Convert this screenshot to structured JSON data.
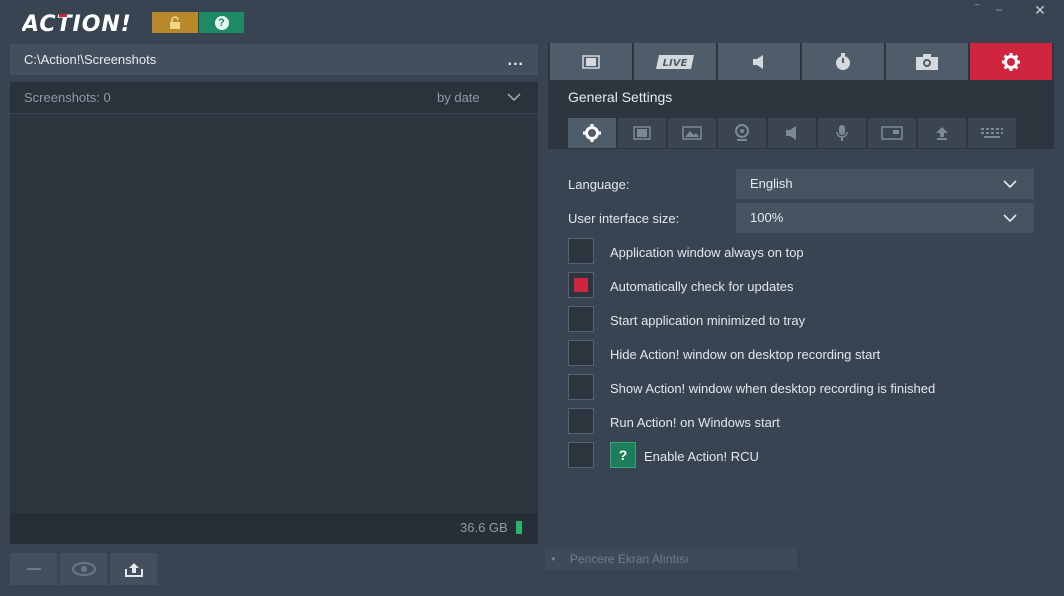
{
  "app": {
    "logo_text": "ACTION!",
    "lock_icon": "lock-icon",
    "help_label": "?",
    "window_buttons": {
      "minimize": "‾",
      "restore": "−",
      "close": "✕"
    }
  },
  "left": {
    "path": "C:\\Action!\\Screenshots",
    "path_more": "...",
    "count_label": "Screenshots: 0",
    "sort_label": "by date",
    "disk_free": "36.6 GB"
  },
  "right": {
    "top_tabs": [
      {
        "name": "video-tab",
        "icon": "film-icon"
      },
      {
        "name": "live-tab",
        "icon": "live-icon",
        "label": "LIVE"
      },
      {
        "name": "audio-tab",
        "icon": "speaker-icon"
      },
      {
        "name": "benchmark-tab",
        "icon": "stopwatch-icon"
      },
      {
        "name": "screenshot-tab",
        "icon": "camera-icon"
      },
      {
        "name": "settings-tab",
        "icon": "gear-icon",
        "active": true
      }
    ],
    "title": "General Settings",
    "sub_tabs": [
      "gear-icon",
      "film-icon",
      "image-icon",
      "webcam-icon",
      "speaker-icon",
      "microphone-icon",
      "window-icon",
      "upload-icon",
      "keyboard-icon"
    ],
    "language_label": "Language:",
    "language_value": "English",
    "ui_size_label": "User interface size:",
    "ui_size_value": "100%",
    "options": [
      {
        "label": "Application window always on top",
        "checked": false
      },
      {
        "label": "Automatically check for updates",
        "checked": true
      },
      {
        "label": "Start application minimized to tray",
        "checked": false
      },
      {
        "label": "Hide Action! window on desktop recording start",
        "checked": false
      },
      {
        "label": "Show Action! window when desktop recording is finished",
        "checked": false
      },
      {
        "label": "Run Action! on Windows start",
        "checked": false
      },
      {
        "label": "Enable Action! RCU",
        "checked": false
      }
    ],
    "rcu_help": "?"
  },
  "tooltip": "Pencere Ekran Alıntısı",
  "colors": {
    "accent": "#d0253f",
    "gold": "#b8892a",
    "green": "#1e8a64"
  }
}
